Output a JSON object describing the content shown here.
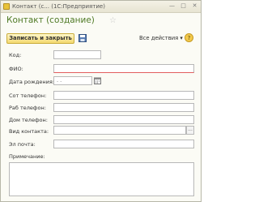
{
  "window": {
    "title": "Контакт (с...  (1С:Предприятие)",
    "min_glyph": "—",
    "max_glyph": "□",
    "close_glyph": "✕"
  },
  "header": {
    "title": "Контакт (создание)",
    "star_glyph": "☆"
  },
  "toolbar": {
    "save_close_label": "Записать и закрыть",
    "save_icon": "floppy-disk-icon",
    "all_actions_label": "Все действия ▾",
    "help_label": "?"
  },
  "form": {
    "code_label": "Код:",
    "code_value": "",
    "fio_label": "ФИО:",
    "fio_value": "",
    "birth_label": "Дата рождения:",
    "birth_value": " .  .",
    "mobile_label": "Сот телефон:",
    "mobile_value": "",
    "work_phone_label": "Раб телефон:",
    "work_phone_value": "",
    "home_phone_label": "Дом телефон:",
    "home_phone_value": "",
    "contact_type_label": "Вид контакта:",
    "contact_type_value": "",
    "contact_type_btn": "...",
    "email_label": "Эл почта:",
    "email_value": "",
    "note_label": "Примечание:",
    "note_value": ""
  },
  "colors": {
    "accent": "#4f7a25",
    "button": "#f3d96f",
    "required": "#e25e5e"
  }
}
